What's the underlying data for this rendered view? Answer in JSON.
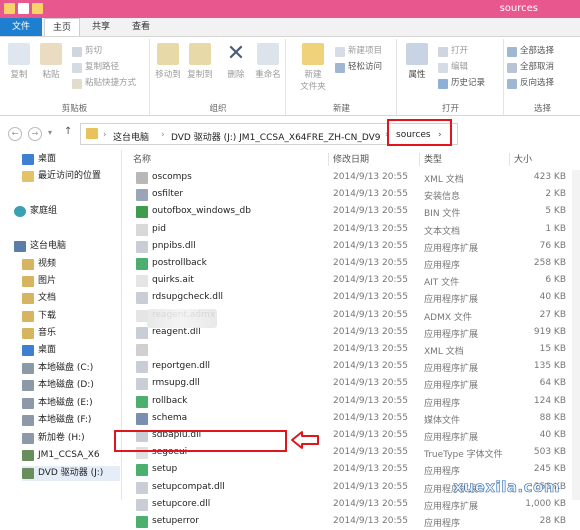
{
  "window": {
    "title": "sources"
  },
  "tabs": {
    "file": "文件",
    "home": "主页",
    "share": "共享",
    "view": "查看"
  },
  "ribbon": {
    "clipboard": {
      "label": "剪贴板",
      "copy": "复制",
      "paste": "粘贴",
      "cut": "剪切",
      "copy_path": "复制路径",
      "paste_shortcut": "粘贴快捷方式"
    },
    "organize": {
      "label": "组织",
      "move_to": "移动到",
      "copy_to": "复制到",
      "delete": "删除",
      "rename": "重命名"
    },
    "new": {
      "label": "新建",
      "new_folder": "新建\n文件夹",
      "new_item": "新建项目",
      "easy_access": "轻松访问"
    },
    "open": {
      "label": "打开",
      "properties": "属性",
      "open": "打开",
      "edit": "编辑",
      "history": "历史记录"
    },
    "select": {
      "label": "选择",
      "select_all": "全部选择",
      "select_none": "全部取消",
      "invert": "反向选择"
    }
  },
  "address": {
    "crumbs": [
      "这台电脑",
      "DVD 驱动器 (J:) JM1_CCSA_X64FRE_ZH-CN_DV9",
      "sources"
    ]
  },
  "nav": {
    "desktop": "桌面",
    "recent": "最近访问的位置",
    "homegroup": "家庭组",
    "thispc": "这台电脑",
    "video": "视频",
    "pictures": "图片",
    "documents": "文档",
    "downloads": "下载",
    "music": "音乐",
    "desktop2": "桌面",
    "disk_c": "本地磁盘 (C:)",
    "disk_d": "本地磁盘 (D:)",
    "disk_e": "本地磁盘 (E:)",
    "disk_f": "本地磁盘 (F:)",
    "vol_h": "新加卷 (H:)",
    "jm1": "JM1_CCSA_X6",
    "dvd": "DVD 驱动器 (J:)"
  },
  "columns": {
    "name": "名称",
    "date": "修改日期",
    "type": "类型",
    "size": "大小"
  },
  "files": [
    {
      "name": "oscomps",
      "date": "2014/9/13 20:55",
      "type": "XML 文档",
      "size": "423 KB",
      "icon": "#b8b8b8"
    },
    {
      "name": "osfilter",
      "date": "2014/9/13 20:55",
      "type": "安装信息",
      "size": "2 KB",
      "icon": "#9aa6b8"
    },
    {
      "name": "outofbox_windows_db",
      "date": "2014/9/13 20:55",
      "type": "BIN 文件",
      "size": "5 KB",
      "icon": "#3f9c4a"
    },
    {
      "name": "pid",
      "date": "2014/9/13 20:55",
      "type": "文本文档",
      "size": "1 KB",
      "icon": "#d8d8d8"
    },
    {
      "name": "pnpibs.dll",
      "date": "2014/9/13 20:55",
      "type": "应用程序扩展",
      "size": "76 KB",
      "icon": "#c9ced6"
    },
    {
      "name": "postrollback",
      "date": "2014/9/13 20:55",
      "type": "应用程序",
      "size": "258 KB",
      "icon": "#4caf6e"
    },
    {
      "name": "quirks.ait",
      "date": "2014/9/13 20:55",
      "type": "AIT 文件",
      "size": "6 KB",
      "icon": "#e5e5e5"
    },
    {
      "name": "rdsupgcheck.dll",
      "date": "2014/9/13 20:55",
      "type": "应用程序扩展",
      "size": "40 KB",
      "icon": "#c9ced6"
    },
    {
      "name": "reagent.admx",
      "date": "2014/9/13 20:55",
      "type": "ADMX 文件",
      "size": "27 KB",
      "icon": "#e5e5e5"
    },
    {
      "name": "reagent.dll",
      "date": "2014/9/13 20:55",
      "type": "应用程序扩展",
      "size": "919 KB",
      "icon": "#c9ced6"
    },
    {
      "name": "",
      "date": "2014/9/13 20:55",
      "type": "XML 文档",
      "size": "15 KB",
      "icon": "#d0d0d0"
    },
    {
      "name": "reportgen.dll",
      "date": "2014/9/13 20:55",
      "type": "应用程序扩展",
      "size": "135 KB",
      "icon": "#c9ced6"
    },
    {
      "name": "rmsupg.dll",
      "date": "2014/9/13 20:55",
      "type": "应用程序扩展",
      "size": "64 KB",
      "icon": "#c9ced6"
    },
    {
      "name": "rollback",
      "date": "2014/9/13 20:55",
      "type": "应用程序",
      "size": "124 KB",
      "icon": "#4caf6e"
    },
    {
      "name": "schema",
      "date": "2014/9/13 20:55",
      "type": "媒体文件",
      "size": "88 KB",
      "icon": "#7a8fb0"
    },
    {
      "name": "sdbapiu.dll",
      "date": "2014/9/13 20:55",
      "type": "应用程序扩展",
      "size": "40 KB",
      "icon": "#c9ced6"
    },
    {
      "name": "segoeui",
      "date": "2014/9/13 20:55",
      "type": "TrueType 字体文件",
      "size": "503 KB",
      "icon": "#e0e0e0"
    },
    {
      "name": "setup",
      "date": "2014/9/13 20:55",
      "type": "应用程序",
      "size": "245 KB",
      "icon": "#4caf6e"
    },
    {
      "name": "setupcompat.dll",
      "date": "2014/9/13 20:55",
      "type": "应用程序扩展",
      "size": "258 KB",
      "icon": "#c9ced6"
    },
    {
      "name": "setupcore.dll",
      "date": "2014/9/13 20:55",
      "type": "应用程序扩展",
      "size": "1,000 KB",
      "icon": "#c9ced6"
    },
    {
      "name": "setuperror",
      "date": "2014/9/13 20:55",
      "type": "应用程序",
      "size": "28 KB",
      "icon": "#4caf6e"
    }
  ],
  "watermark": "xuexila.com",
  "colors": {
    "titlebar": "#e9578f",
    "file_tab": "#1e7fd0",
    "highlight": "#e0161d"
  }
}
